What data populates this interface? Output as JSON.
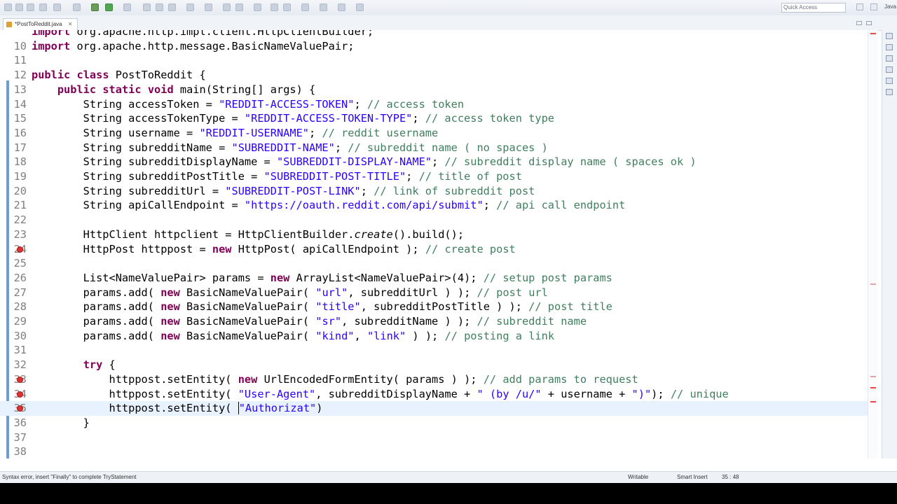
{
  "toolbar": {
    "quick_access_placeholder": "Quick Access",
    "perspective_label": "Java"
  },
  "editor_tab": {
    "title": "*PostToReddit.java",
    "close_glyph": "✕"
  },
  "code_lines": [
    {
      "num": "",
      "spans": [
        {
          "t": "import",
          "c": "kw"
        },
        {
          "t": " org.apache.http.impl.client.HttpClientBuilder;"
        }
      ]
    },
    {
      "num": "10",
      "spans": [
        {
          "t": "import",
          "c": "kw"
        },
        {
          "t": " org.apache.http.message.BasicNameValuePair;"
        }
      ]
    },
    {
      "num": "11",
      "spans": []
    },
    {
      "num": "12",
      "spans": [
        {
          "t": "public",
          "c": "kw"
        },
        {
          "t": " "
        },
        {
          "t": "class",
          "c": "kw"
        },
        {
          "t": " PostToReddit {"
        }
      ]
    },
    {
      "num": "13",
      "spans": [
        {
          "t": "    "
        },
        {
          "t": "public",
          "c": "kw"
        },
        {
          "t": " "
        },
        {
          "t": "static",
          "c": "kw"
        },
        {
          "t": " "
        },
        {
          "t": "void",
          "c": "kw"
        },
        {
          "t": " main(String[] args) {"
        }
      ]
    },
    {
      "num": "14",
      "spans": [
        {
          "t": "        String accessToken = "
        },
        {
          "t": "\"REDDIT-ACCESS-TOKEN\"",
          "c": "str"
        },
        {
          "t": "; "
        },
        {
          "t": "// access token",
          "c": "cmt"
        }
      ]
    },
    {
      "num": "15",
      "spans": [
        {
          "t": "        String accessTokenType = "
        },
        {
          "t": "\"REDDIT-ACCESS-TOKEN-TYPE\"",
          "c": "str"
        },
        {
          "t": "; "
        },
        {
          "t": "// access token type",
          "c": "cmt"
        }
      ]
    },
    {
      "num": "16",
      "spans": [
        {
          "t": "        String username = "
        },
        {
          "t": "\"REDDIT-USERNAME\"",
          "c": "str"
        },
        {
          "t": "; "
        },
        {
          "t": "// reddit username",
          "c": "cmt"
        }
      ]
    },
    {
      "num": "17",
      "spans": [
        {
          "t": "        String subredditName = "
        },
        {
          "t": "\"SUBREDDIT-NAME\"",
          "c": "str"
        },
        {
          "t": "; "
        },
        {
          "t": "// subreddit name ( no spaces )",
          "c": "cmt"
        }
      ]
    },
    {
      "num": "18",
      "spans": [
        {
          "t": "        String subredditDisplayName = "
        },
        {
          "t": "\"SUBREDDIT-DISPLAY-NAME\"",
          "c": "str"
        },
        {
          "t": "; "
        },
        {
          "t": "// subreddit display name ( spaces ok )",
          "c": "cmt"
        }
      ]
    },
    {
      "num": "19",
      "spans": [
        {
          "t": "        String subredditPostTitle = "
        },
        {
          "t": "\"SUBREDDIT-POST-TITLE\"",
          "c": "str"
        },
        {
          "t": "; "
        },
        {
          "t": "// title of post",
          "c": "cmt"
        }
      ]
    },
    {
      "num": "20",
      "spans": [
        {
          "t": "        String subredditUrl = "
        },
        {
          "t": "\"SUBREDDIT-POST-LINK\"",
          "c": "str"
        },
        {
          "t": "; "
        },
        {
          "t": "// link of subreddit post",
          "c": "cmt"
        }
      ]
    },
    {
      "num": "21",
      "spans": [
        {
          "t": "        String apiCallEndpoint = "
        },
        {
          "t": "\"https://oauth.reddit.com/api/submit\"",
          "c": "str"
        },
        {
          "t": "; "
        },
        {
          "t": "// api call endpoint",
          "c": "cmt"
        }
      ]
    },
    {
      "num": "22",
      "spans": []
    },
    {
      "num": "23",
      "spans": [
        {
          "t": "        HttpClient httpclient = HttpClientBuilder."
        },
        {
          "t": "create",
          "c": "it"
        },
        {
          "t": "().build();"
        }
      ]
    },
    {
      "num": "24",
      "spans": [
        {
          "t": "        HttpPost httppost = "
        },
        {
          "t": "new",
          "c": "kw"
        },
        {
          "t": " HttpPost( apiCallEndpoint ); "
        },
        {
          "t": "// create post",
          "c": "cmt"
        }
      ]
    },
    {
      "num": "25",
      "spans": []
    },
    {
      "num": "26",
      "spans": [
        {
          "t": "        List<NameValuePair> params = "
        },
        {
          "t": "new",
          "c": "kw"
        },
        {
          "t": " ArrayList<NameValuePair>(4); "
        },
        {
          "t": "// setup post params",
          "c": "cmt"
        }
      ]
    },
    {
      "num": "27",
      "spans": [
        {
          "t": "        params.add( "
        },
        {
          "t": "new",
          "c": "kw"
        },
        {
          "t": " BasicNameValuePair( "
        },
        {
          "t": "\"url\"",
          "c": "str"
        },
        {
          "t": ", subredditUrl ) ); "
        },
        {
          "t": "// post url",
          "c": "cmt"
        }
      ]
    },
    {
      "num": "28",
      "spans": [
        {
          "t": "        params.add( "
        },
        {
          "t": "new",
          "c": "kw"
        },
        {
          "t": " BasicNameValuePair( "
        },
        {
          "t": "\"title\"",
          "c": "str"
        },
        {
          "t": ", subredditPostTitle ) ); "
        },
        {
          "t": "// post title",
          "c": "cmt"
        }
      ]
    },
    {
      "num": "29",
      "spans": [
        {
          "t": "        params.add( "
        },
        {
          "t": "new",
          "c": "kw"
        },
        {
          "t": " BasicNameValuePair( "
        },
        {
          "t": "\"sr\"",
          "c": "str"
        },
        {
          "t": ", subredditName ) ); "
        },
        {
          "t": "// subreddit name",
          "c": "cmt"
        }
      ]
    },
    {
      "num": "30",
      "spans": [
        {
          "t": "        params.add( "
        },
        {
          "t": "new",
          "c": "kw"
        },
        {
          "t": " BasicNameValuePair( "
        },
        {
          "t": "\"kind\"",
          "c": "str"
        },
        {
          "t": ", "
        },
        {
          "t": "\"link\"",
          "c": "str"
        },
        {
          "t": " ) ); "
        },
        {
          "t": "// posting a link",
          "c": "cmt"
        }
      ]
    },
    {
      "num": "31",
      "spans": []
    },
    {
      "num": "32",
      "spans": [
        {
          "t": "        "
        },
        {
          "t": "try",
          "c": "kw"
        },
        {
          "t": " {"
        }
      ]
    },
    {
      "num": "33",
      "spans": [
        {
          "t": "            httppost.setEntity( "
        },
        {
          "t": "new",
          "c": "kw"
        },
        {
          "t": " UrlEncodedFormEntity( params ) ); "
        },
        {
          "t": "// add params to request",
          "c": "cmt"
        }
      ]
    },
    {
      "num": "34",
      "spans": [
        {
          "t": "            httppost.setEntity( "
        },
        {
          "t": "\"User-Agent\"",
          "c": "str"
        },
        {
          "t": ", subredditDisplayName + "
        },
        {
          "t": "\" (by /u/\"",
          "c": "str"
        },
        {
          "t": " + username + "
        },
        {
          "t": "\")\"",
          "c": "str"
        },
        {
          "t": "); "
        },
        {
          "t": "// unique",
          "c": "cmt"
        }
      ]
    },
    {
      "num": "35",
      "spans": [
        {
          "t": "            httppost.setEntity( "
        },
        {
          "t": "\"Authorizat\"",
          "c": "str"
        },
        {
          "t": ")"
        }
      ]
    },
    {
      "num": "36",
      "spans": [
        {
          "t": "        }"
        }
      ]
    },
    {
      "num": "37",
      "spans": []
    },
    {
      "num": "38",
      "spans": []
    }
  ],
  "current_line": "35",
  "error_lines": [
    "24",
    "33",
    "34",
    "35"
  ],
  "status_bar": {
    "message": "Syntax error, insert \"Finally\" to complete TryStatement",
    "writable": "Writable",
    "insert_mode": "Smart Insert",
    "position": "35 : 48"
  },
  "colors": {
    "keyword": "#7f0055",
    "string": "#2a00ff",
    "comment": "#3f7f5f",
    "current_line_bg": "#e8f2fe",
    "error": "#dd3333"
  }
}
